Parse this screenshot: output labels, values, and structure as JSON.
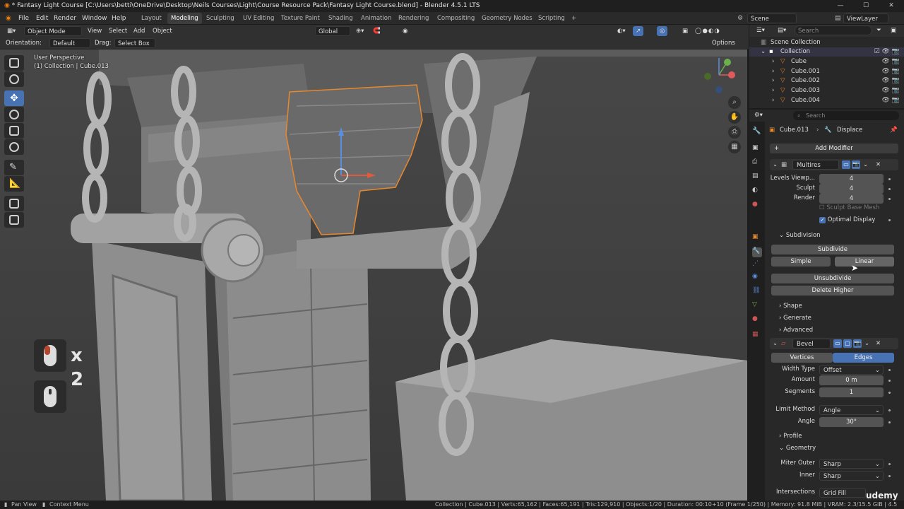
{
  "window": {
    "title": "* Fantasy Light Course [C:\\Users\\betti\\OneDrive\\Desktop\\Neils Courses\\Light\\Course Resource Pack\\Fantasy Light Course.blend] - Blender 4.5.1 LTS",
    "min": "—",
    "max": "☐",
    "close": "✕"
  },
  "menu": [
    "File",
    "Edit",
    "Render",
    "Window",
    "Help"
  ],
  "workspaces": [
    "Layout",
    "Modeling",
    "Sculpting",
    "UV Editing",
    "Texture Paint",
    "Shading",
    "Animation",
    "Rendering",
    "Compositing",
    "Geometry Nodes",
    "Scripting"
  ],
  "active_workspace": "Modeling",
  "add_workspace": "+",
  "scene": {
    "label": "Scene",
    "viewlayer": "ViewLayer"
  },
  "viewport_header": {
    "mode": "Object Mode",
    "menus": [
      "View",
      "Select",
      "Add",
      "Object"
    ],
    "transform": "Global",
    "orientation_label": "Orientation:",
    "orientation_value": "Default",
    "drag_label": "Drag:",
    "drag_value": "Select Box",
    "options": "Options"
  },
  "viewport": {
    "perspective": "User Perspective",
    "collection": "(1) Collection | Cube.013"
  },
  "overlay": {
    "count": "x 2"
  },
  "outliner": {
    "search": "Search",
    "scene_collection": "Scene Collection",
    "collection": "Collection",
    "objects": [
      "Cube",
      "Cube.001",
      "Cube.002",
      "Cube.003",
      "Cube.004"
    ]
  },
  "properties": {
    "search": "Search",
    "breadcrumb_object": "Cube.013",
    "breadcrumb_modifier": "Displace",
    "add_modifier": "Add Modifier",
    "multires": {
      "name": "Multires",
      "levels_viewport_label": "Levels Viewp...",
      "levels_viewport": "4",
      "sculpt_label": "Sculpt",
      "sculpt": "4",
      "render_label": "Render",
      "render": "4",
      "sculpt_base_mesh": "Sculpt Base Mesh",
      "optimal_display": "Optimal Display",
      "subdivision_header": "Subdivision",
      "subdivide": "Subdivide",
      "simple": "Simple",
      "linear": "Linear",
      "unsubdivide": "Unsubdivide",
      "delete_higher": "Delete Higher",
      "shape": "Shape",
      "generate": "Generate",
      "advanced": "Advanced"
    },
    "bevel": {
      "name": "Bevel",
      "vertices": "Vertices",
      "edges": "Edges",
      "width_type_label": "Width Type",
      "width_type": "Offset",
      "amount_label": "Amount",
      "amount": "0 m",
      "segments_label": "Segments",
      "segments": "1",
      "limit_method_label": "Limit Method",
      "limit_method": "Angle",
      "angle_label": "Angle",
      "angle": "30°",
      "profile": "Profile",
      "geometry": "Geometry",
      "miter_outer_label": "Miter Outer",
      "miter_outer": "Sharp",
      "inner_label": "Inner",
      "inner": "Sharp",
      "intersections_label": "Intersections",
      "intersections": "Grid Fill"
    }
  },
  "statusbar": {
    "pan": "Pan View",
    "context": "Context Menu",
    "stats": "Collection | Cube.013 | Verts:65,162 | Faces:65,191 | Tris:129,910 | Objects:1/20 | Duration: 00:10+10 (Frame 1/250) | Memory: 91.8 MiB | VRAM: 2.3/15.5 GiB | 4.5"
  },
  "watermark": "udemy",
  "colors": {
    "accent": "#4772b3",
    "selection": "#e8882d",
    "viewport_bg": "#3f3f3f",
    "panel_bg": "#282828"
  }
}
